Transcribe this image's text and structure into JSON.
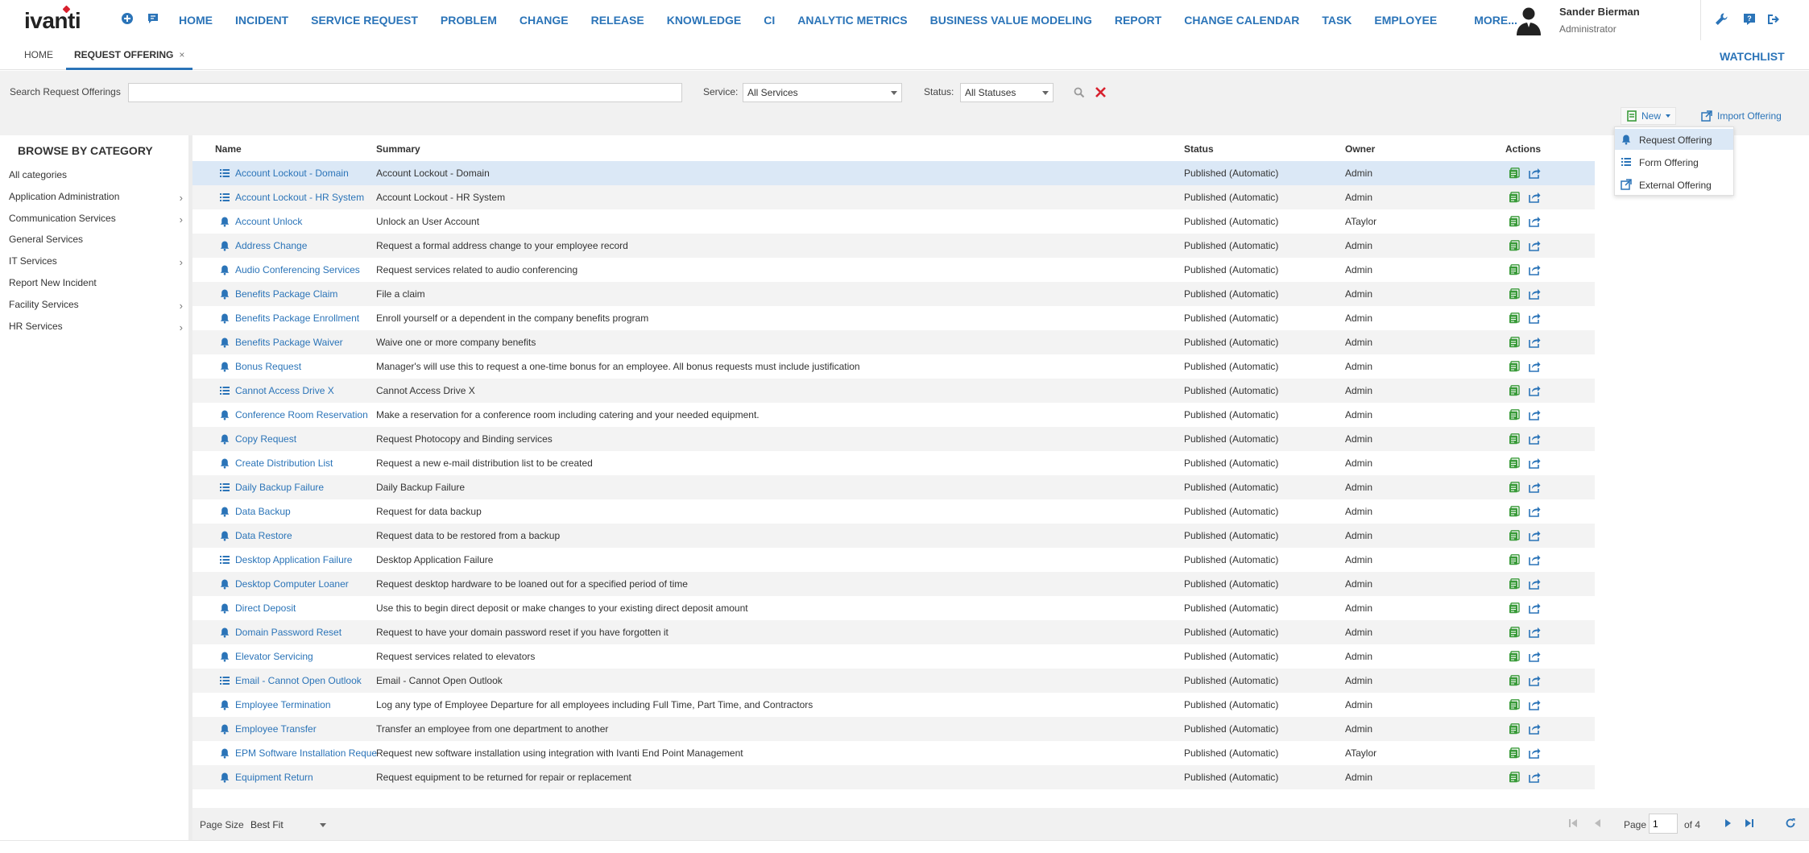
{
  "brand": "ivanti",
  "colors": {
    "accent": "#2b74b8",
    "danger": "#d8202d",
    "action_green": "#3a9b3a",
    "selected_row": "#dbe8f6"
  },
  "nav": [
    "HOME",
    "INCIDENT",
    "SERVICE REQUEST",
    "PROBLEM",
    "CHANGE",
    "RELEASE",
    "KNOWLEDGE",
    "CI",
    "ANALYTIC METRICS",
    "BUSINESS VALUE MODELING",
    "REPORT",
    "CHANGE CALENDAR",
    "TASK",
    "EMPLOYEE",
    "MORE..."
  ],
  "user": {
    "name": "Sander Bierman",
    "role": "Administrator"
  },
  "tabs": {
    "home": "HOME",
    "active": "REQUEST OFFERING",
    "close": "×"
  },
  "watchlist": "WATCHLIST",
  "search": {
    "label": "Search Request Offerings",
    "value": "",
    "service_label": "Service:",
    "service_value": "All Services",
    "status_label": "Status:",
    "status_value": "All Statuses"
  },
  "toolbar": {
    "new_label": "New",
    "import_label": "Import Offering"
  },
  "new_menu": [
    {
      "label": "Request Offering",
      "icon": "bell-icon"
    },
    {
      "label": "Form Offering",
      "icon": "list-icon"
    },
    {
      "label": "External Offering",
      "icon": "external-link-icon"
    }
  ],
  "sidebar": {
    "title": "BROWSE BY CATEGORY",
    "categories": [
      {
        "label": "All categories",
        "expandable": false
      },
      {
        "label": "Application Administration",
        "expandable": true
      },
      {
        "label": "Communication Services",
        "expandable": true
      },
      {
        "label": "General Services",
        "expandable": false
      },
      {
        "label": "IT Services",
        "expandable": true
      },
      {
        "label": "Report New Incident",
        "expandable": false
      },
      {
        "label": "Facility Services",
        "expandable": true
      },
      {
        "label": "HR Services",
        "expandable": true
      }
    ]
  },
  "table": {
    "columns": {
      "name": "Name",
      "summary": "Summary",
      "status": "Status",
      "owner": "Owner",
      "actions": "Actions"
    },
    "rows": [
      {
        "type": "list",
        "name": "Account Lockout - Domain",
        "summary": "Account Lockout - Domain",
        "status": "Published (Automatic)",
        "owner": "Admin"
      },
      {
        "type": "list",
        "name": "Account Lockout - HR System",
        "summary": "Account Lockout - HR System",
        "status": "Published (Automatic)",
        "owner": "Admin"
      },
      {
        "type": "bell",
        "name": "Account Unlock",
        "summary": "Unlock an User Account",
        "status": "Published (Automatic)",
        "owner": "ATaylor"
      },
      {
        "type": "bell",
        "name": "Address Change",
        "summary": "Request a formal address change to your employee record",
        "status": "Published (Automatic)",
        "owner": "Admin"
      },
      {
        "type": "bell",
        "name": "Audio Conferencing Services",
        "summary": "Request services related to audio conferencing",
        "status": "Published (Automatic)",
        "owner": "Admin"
      },
      {
        "type": "bell",
        "name": "Benefits Package Claim",
        "summary": "File a claim",
        "status": "Published (Automatic)",
        "owner": "Admin"
      },
      {
        "type": "bell",
        "name": "Benefits Package Enrollment",
        "summary": "Enroll yourself or a dependent in the company benefits program",
        "status": "Published (Automatic)",
        "owner": "Admin"
      },
      {
        "type": "bell",
        "name": "Benefits Package Waiver",
        "summary": "Waive one or more company benefits",
        "status": "Published (Automatic)",
        "owner": "Admin"
      },
      {
        "type": "bell",
        "name": "Bonus Request",
        "summary": "Manager's will use this to request a one-time bonus for an employee. All bonus requests must include justification",
        "status": "Published (Automatic)",
        "owner": "Admin"
      },
      {
        "type": "list",
        "name": "Cannot Access Drive X",
        "summary": "Cannot Access Drive X",
        "status": "Published (Automatic)",
        "owner": "Admin"
      },
      {
        "type": "bell",
        "name": "Conference Room Reservation",
        "summary": "Make a reservation for a conference room including catering and your needed equipment.",
        "status": "Published (Automatic)",
        "owner": "Admin"
      },
      {
        "type": "bell",
        "name": "Copy Request",
        "summary": "Request Photocopy and Binding services",
        "status": "Published (Automatic)",
        "owner": "Admin"
      },
      {
        "type": "bell",
        "name": "Create Distribution List",
        "summary": "Request a new e-mail distribution list to be created",
        "status": "Published (Automatic)",
        "owner": "Admin"
      },
      {
        "type": "list",
        "name": "Daily Backup Failure",
        "summary": "Daily Backup Failure",
        "status": "Published (Automatic)",
        "owner": "Admin"
      },
      {
        "type": "bell",
        "name": "Data Backup",
        "summary": "Request for data backup",
        "status": "Published (Automatic)",
        "owner": "Admin"
      },
      {
        "type": "bell",
        "name": "Data Restore",
        "summary": "Request data to be restored from a backup",
        "status": "Published (Automatic)",
        "owner": "Admin"
      },
      {
        "type": "list",
        "name": "Desktop Application Failure",
        "summary": "Desktop Application Failure",
        "status": "Published (Automatic)",
        "owner": "Admin"
      },
      {
        "type": "bell",
        "name": "Desktop Computer Loaner",
        "summary": "Request desktop hardware to be loaned out for a specified period of time",
        "status": "Published (Automatic)",
        "owner": "Admin"
      },
      {
        "type": "bell",
        "name": "Direct Deposit",
        "summary": "Use this to begin direct deposit or make changes to your existing direct deposit amount",
        "status": "Published (Automatic)",
        "owner": "Admin"
      },
      {
        "type": "bell",
        "name": "Domain Password Reset",
        "summary": "Request to have your domain password reset if you have forgotten it",
        "status": "Published (Automatic)",
        "owner": "Admin"
      },
      {
        "type": "bell",
        "name": "Elevator Servicing",
        "summary": "Request services related to elevators",
        "status": "Published (Automatic)",
        "owner": "Admin"
      },
      {
        "type": "list",
        "name": "Email - Cannot Open Outlook",
        "summary": "Email - Cannot Open Outlook",
        "status": "Published (Automatic)",
        "owner": "Admin"
      },
      {
        "type": "bell",
        "name": "Employee Termination",
        "summary": "Log any type of Employee Departure for all employees including Full Time, Part Time, and Contractors",
        "status": "Published (Automatic)",
        "owner": "Admin"
      },
      {
        "type": "bell",
        "name": "Employee Transfer",
        "summary": "Transfer an employee from one department to another",
        "status": "Published (Automatic)",
        "owner": "Admin"
      },
      {
        "type": "bell",
        "name": "EPM Software Installation Request",
        "summary": "Request new software installation using integration with Ivanti End Point Management",
        "status": "Published (Automatic)",
        "owner": "ATaylor"
      },
      {
        "type": "bell",
        "name": "Equipment Return",
        "summary": "Request equipment to be returned for repair or replacement",
        "status": "Published (Automatic)",
        "owner": "Admin"
      }
    ]
  },
  "footer": {
    "page_size_label": "Page Size",
    "page_size_value": "Best Fit",
    "page_label": "Page",
    "page_value": "1",
    "page_of": "of 4"
  }
}
